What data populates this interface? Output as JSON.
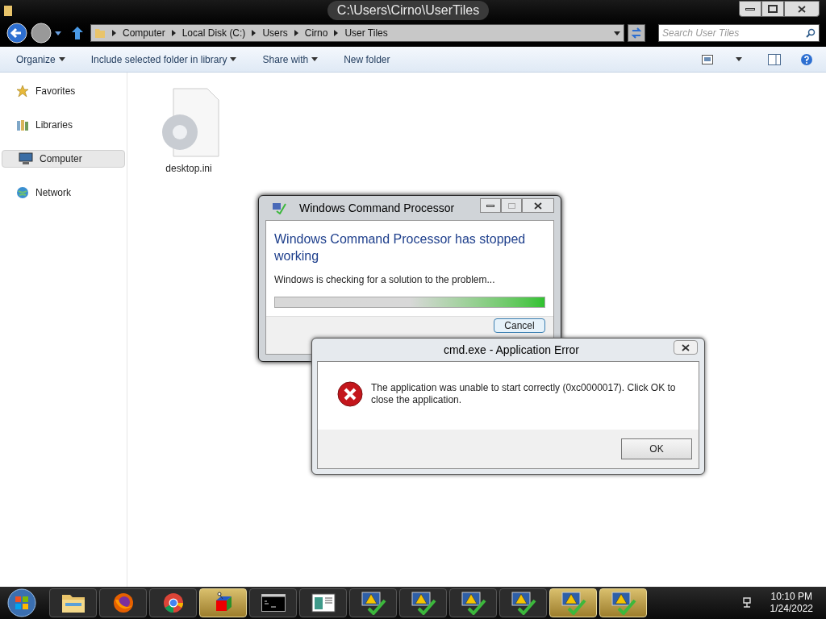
{
  "window": {
    "title": "C:\\Users\\Cirno\\UserTiles"
  },
  "address_bar": {
    "crumbs": [
      "Computer",
      "Local Disk (C:)",
      "Users",
      "Cirno",
      "User Tiles"
    ]
  },
  "search": {
    "placeholder": "Search User Tiles"
  },
  "toolbar": {
    "items": [
      {
        "label": "Organize",
        "dropdown": true
      },
      {
        "label": "Include selected folder in library",
        "dropdown": true
      },
      {
        "label": "Share with",
        "dropdown": true
      },
      {
        "label": "New folder",
        "dropdown": false
      }
    ]
  },
  "sidebar": {
    "items": [
      {
        "label": "Favorites",
        "kind": "star",
        "selected": false
      },
      {
        "label": "Libraries",
        "kind": "library",
        "selected": false
      },
      {
        "label": "Computer",
        "kind": "computer",
        "selected": true
      },
      {
        "label": "Network",
        "kind": "network",
        "selected": false
      }
    ]
  },
  "files": [
    {
      "name": "desktop.ini"
    }
  ],
  "dialog_progress": {
    "title": "Windows Command Processor",
    "heading": "Windows Command Processor has stopped working",
    "message": "Windows is checking for a solution to the problem...",
    "level": 1,
    "button": "Cancel"
  },
  "dialog_error": {
    "title": "cmd.exe - Application Error",
    "message": "The application was unable to start correctly (0xc0000017). Click OK to close the application.",
    "button": "OK"
  },
  "taskbar": {
    "items": [
      {
        "kind": "explorer",
        "highlighted": false
      },
      {
        "kind": "firefox",
        "highlighted": false
      },
      {
        "kind": "chrome",
        "highlighted": false
      },
      {
        "kind": "paint",
        "highlighted": true
      },
      {
        "kind": "cmd",
        "highlighted": false
      },
      {
        "kind": "window",
        "highlighted": false
      },
      {
        "kind": "warning",
        "highlighted": false
      },
      {
        "kind": "warning",
        "highlighted": false
      },
      {
        "kind": "warning",
        "highlighted": false
      },
      {
        "kind": "warning",
        "highlighted": false
      },
      {
        "kind": "warning",
        "highlighted": true
      },
      {
        "kind": "warning",
        "highlighted": true
      }
    ],
    "time": "10:10 PM",
    "date": "1/24/2022"
  }
}
